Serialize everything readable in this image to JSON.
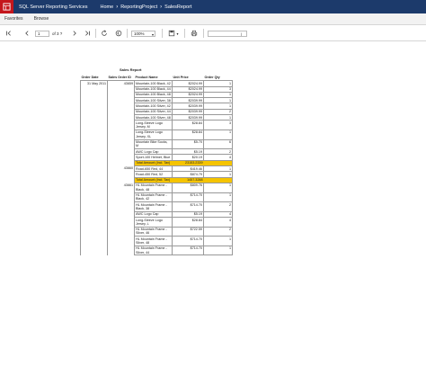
{
  "header": {
    "app_title": "SQL Server Reporting Services",
    "breadcrumbs": [
      "Home",
      "ReportingProject",
      "SalesReport"
    ]
  },
  "menu": {
    "favorites": "Favorites",
    "browse": "Browse"
  },
  "toolbar": {
    "page_number": "1",
    "of_pages": "of 3 ?",
    "zoom": "100%",
    "search_value": "",
    "find_label": "|"
  },
  "report": {
    "title": "Sales Report",
    "columns": [
      "Order Date",
      "Sales Order ID",
      "Product Name",
      "Unit Price",
      "Order Qty"
    ],
    "date": "31 May 2011",
    "orders": [
      {
        "id": "43659",
        "lines": [
          {
            "product": "Mountain-100 Black, 42",
            "price": "$2024.99",
            "qty": "1"
          },
          {
            "product": "Mountain-100 Black, 44",
            "price": "$2024.99",
            "qty": "3"
          },
          {
            "product": "Mountain-100 Black, 48",
            "price": "$2024.99",
            "qty": "1"
          },
          {
            "product": "Mountain-100 Silver, 38",
            "price": "$2039.99",
            "qty": "1"
          },
          {
            "product": "Mountain-100 Silver, 42",
            "price": "$2039.99",
            "qty": "1"
          },
          {
            "product": "Mountain-100 Silver, 44",
            "price": "$2039.99",
            "qty": "2"
          },
          {
            "product": "Mountain-100 Silver, 48",
            "price": "$2039.99",
            "qty": "1"
          },
          {
            "product": "Long-Sleeve Logo Jersey, M",
            "price": "$28.84",
            "qty": "3"
          },
          {
            "product": "Long-Sleeve Logo Jersey, XL",
            "price": "$28.84",
            "qty": "1"
          },
          {
            "product": "Mountain Bike Socks, M",
            "price": "$5.70",
            "qty": "6"
          },
          {
            "product": "AWC Logo Cap",
            "price": "$5.19",
            "qty": "2"
          },
          {
            "product": "Sport-100 Helmet, Blue",
            "price": "$20.19",
            "qty": "4"
          }
        ],
        "total_label": "Total Amount (Incl. Tax)",
        "total_value": "23153.2339"
      },
      {
        "id": "43660",
        "lines": [
          {
            "product": "Road-650 Red, 44",
            "price": "$419.46",
            "qty": "1"
          },
          {
            "product": "Road-450 Red, 52",
            "price": "$874.79",
            "qty": "1"
          }
        ],
        "total_label": "Total Amount (Incl. Tax)",
        "total_value": "1457.3288"
      },
      {
        "id": "43661",
        "lines": [
          {
            "product": "HL Mountain Frame - Black, 48",
            "price": "$809.76",
            "qty": "1"
          },
          {
            "product": "HL Mountain Frame - Black, 42",
            "price": "$714.70",
            "qty": "1"
          },
          {
            "product": "HL Mountain Frame - Black, 38",
            "price": "$714.70",
            "qty": "2"
          },
          {
            "product": "AWC Logo Cap",
            "price": "$5.19",
            "qty": "4"
          },
          {
            "product": "Long-Sleeve Logo Jersey, L",
            "price": "$28.84",
            "qty": "4"
          },
          {
            "product": "HL Mountain Frame - Silver, 46",
            "price": "$722.59",
            "qty": "2"
          },
          {
            "product": "HL Mountain Frame - Silver, 48",
            "price": "$714.70",
            "qty": "1"
          },
          {
            "product": "HL Mountain Frame - Silver, 44",
            "price": "$714.70",
            "qty": "1"
          }
        ]
      }
    ]
  }
}
